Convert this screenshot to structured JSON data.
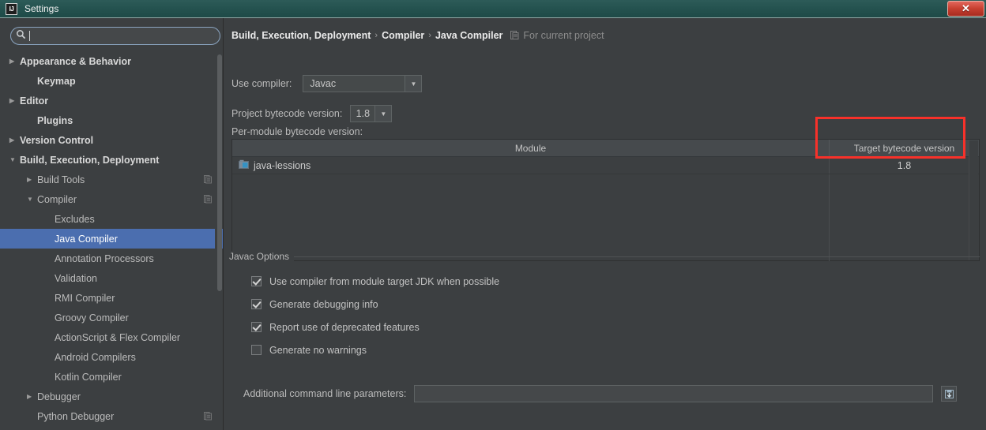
{
  "window": {
    "title": "Settings",
    "app_icon": "IJ",
    "close_label": "✕"
  },
  "sidebar": {
    "search": {
      "value": "",
      "placeholder": ""
    },
    "items": [
      {
        "label": "Appearance & Behavior",
        "arrow": "▶",
        "indent": 0,
        "bold": true,
        "selected": false,
        "config_icon": false
      },
      {
        "label": "Keymap",
        "arrow": "",
        "indent": 1,
        "bold": true,
        "selected": false,
        "config_icon": false
      },
      {
        "label": "Editor",
        "arrow": "▶",
        "indent": 0,
        "bold": true,
        "selected": false,
        "config_icon": false
      },
      {
        "label": "Plugins",
        "arrow": "",
        "indent": 1,
        "bold": true,
        "selected": false,
        "config_icon": false
      },
      {
        "label": "Version Control",
        "arrow": "▶",
        "indent": 0,
        "bold": true,
        "selected": false,
        "config_icon": false
      },
      {
        "label": "Build, Execution, Deployment",
        "arrow": "▼",
        "indent": 0,
        "bold": true,
        "selected": false,
        "config_icon": false
      },
      {
        "label": "Build Tools",
        "arrow": "▶",
        "indent": 1,
        "bold": false,
        "selected": false,
        "config_icon": true
      },
      {
        "label": "Compiler",
        "arrow": "▼",
        "indent": 1,
        "bold": false,
        "selected": false,
        "config_icon": true
      },
      {
        "label": "Excludes",
        "arrow": "",
        "indent": 2,
        "bold": false,
        "selected": false,
        "config_icon": false
      },
      {
        "label": "Java Compiler",
        "arrow": "",
        "indent": 2,
        "bold": false,
        "selected": true,
        "config_icon": false
      },
      {
        "label": "Annotation Processors",
        "arrow": "",
        "indent": 2,
        "bold": false,
        "selected": false,
        "config_icon": false
      },
      {
        "label": "Validation",
        "arrow": "",
        "indent": 2,
        "bold": false,
        "selected": false,
        "config_icon": false
      },
      {
        "label": "RMI Compiler",
        "arrow": "",
        "indent": 2,
        "bold": false,
        "selected": false,
        "config_icon": false
      },
      {
        "label": "Groovy Compiler",
        "arrow": "",
        "indent": 2,
        "bold": false,
        "selected": false,
        "config_icon": false
      },
      {
        "label": "ActionScript & Flex Compiler",
        "arrow": "",
        "indent": 2,
        "bold": false,
        "selected": false,
        "config_icon": false
      },
      {
        "label": "Android Compilers",
        "arrow": "",
        "indent": 2,
        "bold": false,
        "selected": false,
        "config_icon": false
      },
      {
        "label": "Kotlin Compiler",
        "arrow": "",
        "indent": 2,
        "bold": false,
        "selected": false,
        "config_icon": false
      },
      {
        "label": "Debugger",
        "arrow": "▶",
        "indent": 1,
        "bold": false,
        "selected": false,
        "config_icon": false
      },
      {
        "label": "Python Debugger",
        "arrow": "",
        "indent": 1,
        "bold": false,
        "selected": false,
        "config_icon": true
      }
    ]
  },
  "breadcrumb": {
    "parts": [
      "Build, Execution, Deployment",
      "Compiler",
      "Java Compiler"
    ],
    "separator": "›",
    "scope_text": "For current project"
  },
  "form": {
    "use_compiler_label": "Use compiler:",
    "use_compiler_value": "Javac",
    "project_bytecode_label": "Project bytecode version:",
    "project_bytecode_value": "1.8",
    "per_module_label": "Per-module bytecode version:",
    "dropdown_arrow": "▼"
  },
  "table": {
    "columns": [
      "Module",
      "Target bytecode version"
    ],
    "rows": [
      {
        "module": "java-lessions",
        "target": "1.8"
      }
    ]
  },
  "javac_options": {
    "title": "Javac Options",
    "checkboxes": [
      {
        "label": "Use compiler from module target JDK when possible",
        "checked": true
      },
      {
        "label": "Generate debugging info",
        "checked": true
      },
      {
        "label": "Report use of deprecated features",
        "checked": true
      },
      {
        "label": "Generate no warnings",
        "checked": false
      }
    ],
    "params_label": "Additional command line parameters:",
    "params_value": "",
    "params_placeholder": ""
  },
  "annotation": {
    "highlight_color": "#f8312a"
  }
}
